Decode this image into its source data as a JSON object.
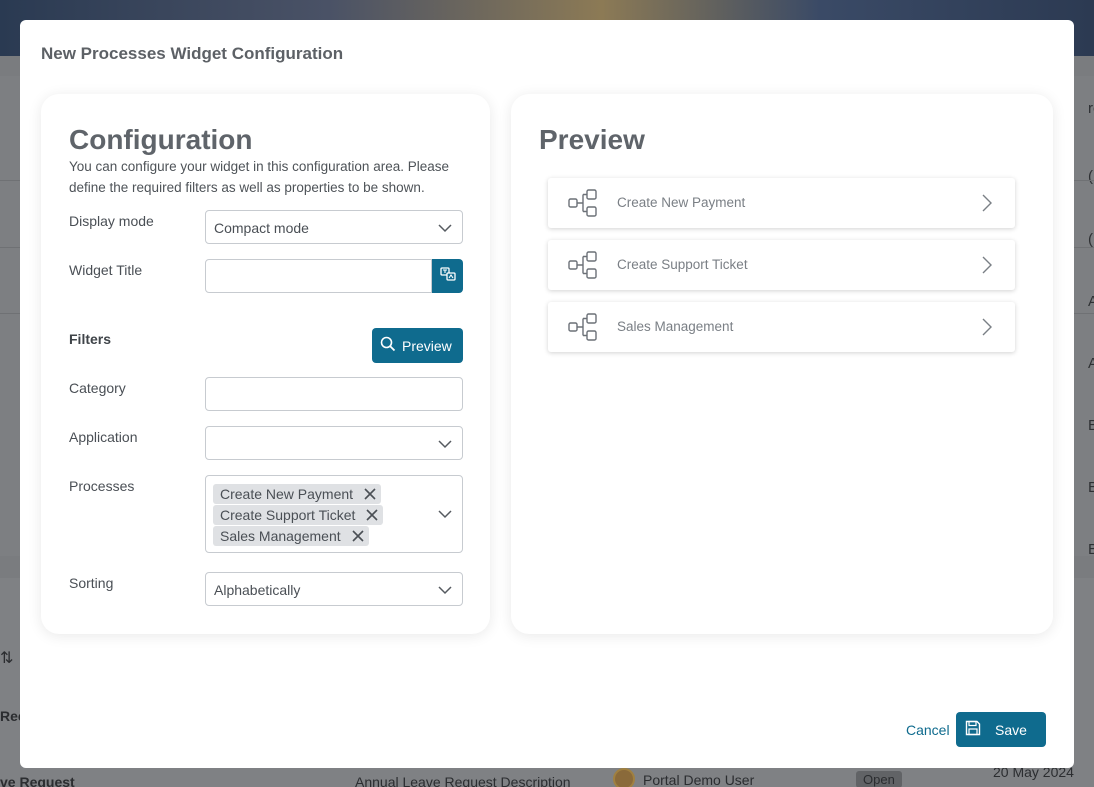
{
  "background": {
    "right_column": [
      "roc",
      "(",
      "(",
      "A",
      "A",
      "B",
      "B",
      "B"
    ],
    "table": {
      "sort_icon": "sort-arrows-icon",
      "partial_header": "Rec",
      "row": {
        "name": "ve Request",
        "description": "Annual Leave Request Description",
        "user": "Portal Demo User",
        "status": "Open",
        "date": "20 May 2024"
      }
    }
  },
  "modal": {
    "title": "New Processes Widget Configuration",
    "configuration": {
      "heading": "Configuration",
      "description": "You can configure your widget in this configuration area. Please define the required filters as well as properties to be shown.",
      "display_mode": {
        "label": "Display mode",
        "value": "Compact mode"
      },
      "widget_title": {
        "label": "Widget Title",
        "value": "",
        "translate_icon": "translate-icon"
      },
      "filters_label": "Filters",
      "preview_button": "Preview",
      "category": {
        "label": "Category",
        "value": ""
      },
      "application": {
        "label": "Application",
        "value": ""
      },
      "processes": {
        "label": "Processes",
        "selected": [
          "Create New Payment",
          "Create Support Ticket",
          "Sales Management"
        ]
      },
      "sorting": {
        "label": "Sorting",
        "value": "Alphabetically"
      }
    },
    "preview": {
      "heading": "Preview",
      "items": [
        {
          "label": "Create New Payment",
          "icon": "process-flow-icon"
        },
        {
          "label": "Create Support Ticket",
          "icon": "process-flow-icon"
        },
        {
          "label": "Sales Management",
          "icon": "process-flow-icon"
        }
      ]
    },
    "footer": {
      "cancel": "Cancel",
      "save": "Save",
      "save_icon": "floppy-disk-icon"
    }
  },
  "colors": {
    "primary": "#0f6b8e",
    "chip_bg": "#dfe1e4",
    "overlay": "#7a7c7f"
  }
}
